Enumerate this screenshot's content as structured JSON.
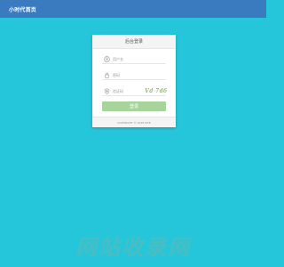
{
  "header": {
    "brand": "小时代首页",
    "background": "#3a7bbf"
  },
  "page": {
    "background": "#26c6da"
  },
  "login": {
    "title": "后台登录",
    "username": {
      "placeholder": "用户名",
      "value": "",
      "icon": "user-icon"
    },
    "password": {
      "placeholder": "密码",
      "value": "",
      "icon": "lock-icon"
    },
    "captcha": {
      "placeholder": "验证码",
      "value": "",
      "icon": "shield-icon",
      "image_text": "Vd 7d6"
    },
    "submit_label": "登录",
    "submit_color": "#a7d49b",
    "copyright": "COPYRIGHT © 2018 SITE"
  },
  "watermark": {
    "text": "网站收录网"
  }
}
